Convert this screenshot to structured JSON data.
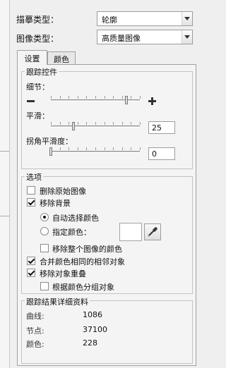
{
  "header": {
    "trace_type_label": "描摹类型：",
    "trace_type_value": "轮廓",
    "image_type_label": "图像类型：",
    "image_type_value": "高质量图像"
  },
  "tabs": [
    {
      "label": "设置",
      "active": true
    },
    {
      "label": "颜色",
      "active": false
    }
  ],
  "tracing": {
    "legend": "跟踪控件",
    "detail_label": "细节：",
    "detail_level": 0.85,
    "smooth_label": "平滑：",
    "smooth_value": "25",
    "smooth_level": 0.25,
    "corner_label": "拐角平滑度：",
    "corner_value": "0",
    "corner_level": 0.0
  },
  "options": {
    "legend": "选项",
    "delete_original": {
      "label": "删除原始图像",
      "checked": false
    },
    "remove_bg": {
      "label": "移除背景",
      "checked": true
    },
    "auto_color": {
      "label": "自动选择颜色",
      "selected": true
    },
    "specify_color": {
      "label": "指定颜色：",
      "selected": false
    },
    "remove_all_color": {
      "label": "移除整个图像的颜色",
      "checked": false
    },
    "merge_adjacent": {
      "label": "合并颜色相同的相邻对象",
      "checked": true
    },
    "remove_overlap": {
      "label": "移除对象重叠",
      "checked": true
    },
    "group_by_color": {
      "label": "根据颜色分组对象",
      "checked": false
    }
  },
  "results": {
    "legend": "跟踪结果详细资料",
    "curves_label": "曲线:",
    "curves_value": "1086",
    "nodes_label": "节点:",
    "nodes_value": "37100",
    "colors_label": "颜色:",
    "colors_value": "228"
  },
  "icons": {
    "minus": "minus-icon",
    "plus": "plus-icon",
    "eyedropper": "eyedropper-icon"
  }
}
